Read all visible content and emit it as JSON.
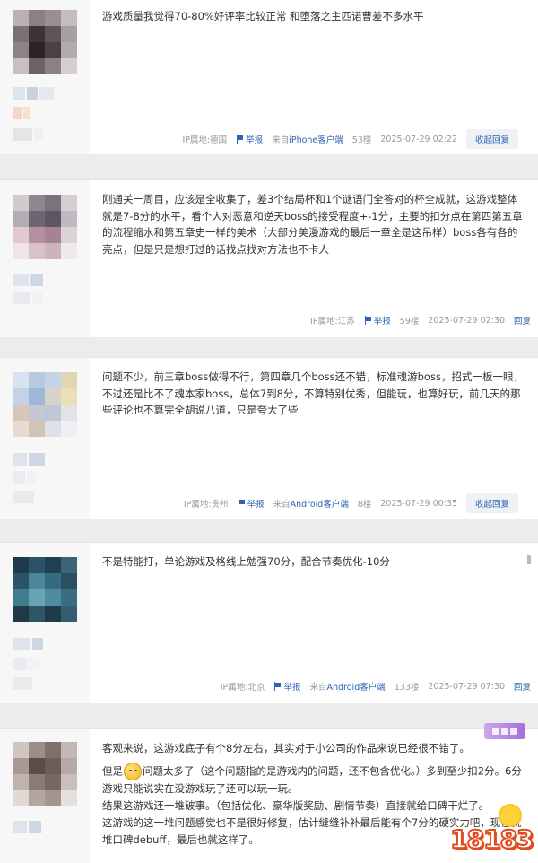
{
  "posts": [
    {
      "content": [
        "游戏质量我觉得70-80%好评率比较正常 和堕落之主匹诺曹差不多水平"
      ],
      "location": "IP属地:德国",
      "report_label": "举报",
      "source_prefix": "来自",
      "source_client": "iPhone客户端",
      "floor": "53楼",
      "time": "2025-07-29 02:22",
      "reply_label": "收起回复"
    },
    {
      "content": [
        "刚通关一周目，应该是全收集了，差3个结局杯和1个谜语门全答对的杯全成就，这游戏整体就是7-8分的水平，看个人对恶意和逆天boss的接受程度+-1分，主要的扣分点在第四第五章的流程缩水和第五章史一样的美术（大部分美漫游戏的最后一章全是这吊样）boss各有各的亮点，但是只是想打过的话找点找对方法也不卡人"
      ],
      "location": "IP属地:江苏",
      "report_label": "举报",
      "source_prefix": "",
      "source_client": "",
      "floor": "59楼",
      "time": "2025-07-29 02:30",
      "reply_label": "回复"
    },
    {
      "content": [
        "问题不少，前三章boss做得不行，第四章几个boss还不错，标准魂游boss，招式一板一眼，不过还是比不了魂本家boss，总体7到8分，不算特别优秀，但能玩，也算好玩，前几天的那些评论也不算完全胡说八道，只是夸大了些"
      ],
      "location": "IP属地:贵州",
      "report_label": "举报",
      "source_prefix": "来自",
      "source_client": "Android客户端",
      "floor": "8楼",
      "time": "2025-07-29 00:35",
      "reply_label": "收起回复"
    },
    {
      "content": [
        "不是特能打，单论游戏及格线上勉强70分，配合节奏优化-10分"
      ],
      "location": "IP属地:北京",
      "report_label": "举报",
      "source_prefix": "来自",
      "source_client": "Android客户端",
      "floor": "133楼",
      "time": "2025-07-29 07:30",
      "reply_label": "回复"
    },
    {
      "content": [
        "客观来说，这游戏底子有个8分左右，其实对于小公司的作品来说已经很不错了。",
        "但是",
        "问题太多了（这个问题指的是游戏内的问题，还不包含优化。）多到至少扣2分。6分游戏只能说实在没游戏玩了还可以玩一玩。",
        "结果这游戏还一堆破事。（包括优化、豪华版奖励、剧情节奏）直接就给口碑干烂了。",
        "这游戏的这一堆问题感觉也不是很好修复，估计缝缝补补最后能有个7分的硬实力吧，现在就堆口碑debuff，最后也就这样了。"
      ],
      "watermark": "18183"
    }
  ]
}
